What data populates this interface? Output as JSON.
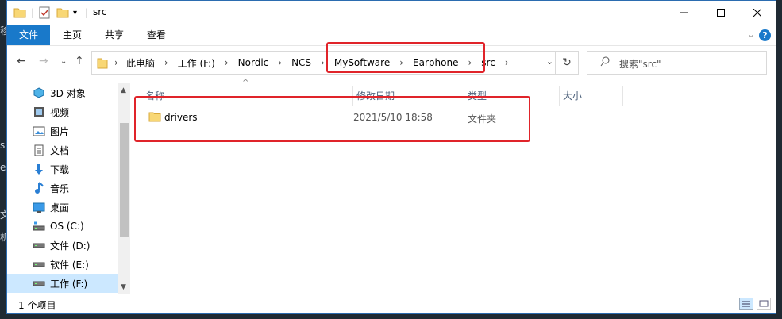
{
  "window": {
    "title": "src"
  },
  "background_fragments": [
    "移",
    "s",
    "el",
    "文",
    "析"
  ],
  "ribbon": {
    "tabs": [
      "文件",
      "主页",
      "共享",
      "查看"
    ]
  },
  "address": {
    "crumbs": [
      "此电脑",
      "工作 (F:)",
      "Nordic",
      "NCS",
      "MySoftware",
      "Earphone",
      "src"
    ]
  },
  "search": {
    "placeholder": "搜索\"src\""
  },
  "nav_pane": {
    "items": [
      {
        "label": "3D 对象",
        "icon": "3d-objects-icon"
      },
      {
        "label": "视频",
        "icon": "video-icon"
      },
      {
        "label": "图片",
        "icon": "pictures-icon"
      },
      {
        "label": "文档",
        "icon": "documents-icon"
      },
      {
        "label": "下载",
        "icon": "download-icon"
      },
      {
        "label": "音乐",
        "icon": "music-icon"
      },
      {
        "label": "桌面",
        "icon": "desktop-icon"
      },
      {
        "label": "OS (C:)",
        "icon": "drive-icon"
      },
      {
        "label": "文件 (D:)",
        "icon": "drive-icon"
      },
      {
        "label": "软件 (E:)",
        "icon": "drive-icon"
      },
      {
        "label": "工作 (F:)",
        "icon": "drive-icon",
        "selected": true
      }
    ]
  },
  "file_list": {
    "columns": [
      "名称",
      "修改日期",
      "类型",
      "大小"
    ],
    "rows": [
      {
        "name": "drivers",
        "modified": "2021/5/10 18:58",
        "type": "文件夹",
        "size": ""
      }
    ]
  },
  "status": {
    "item_count": "1 个项目"
  },
  "colors": {
    "accent": "#1979ca",
    "highlight": "#e0242a",
    "selected": "#cce8ff"
  }
}
